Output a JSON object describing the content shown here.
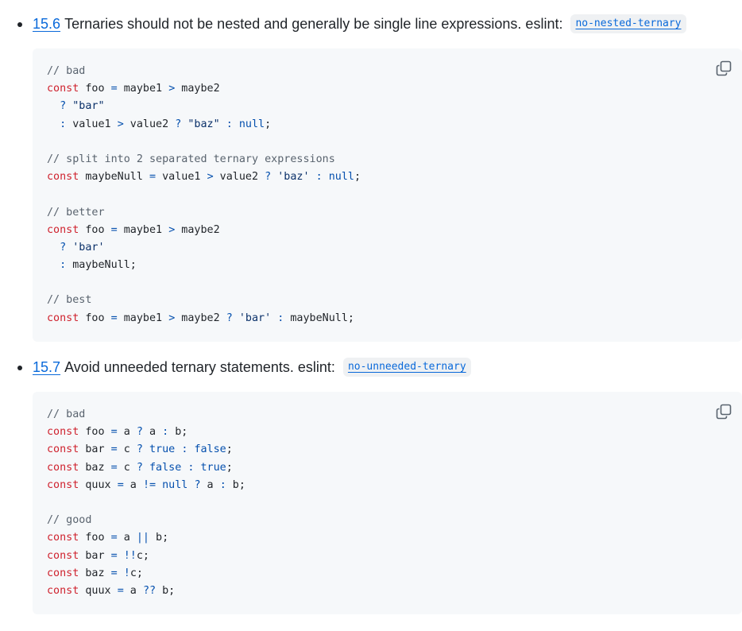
{
  "sections": [
    {
      "number": "15.6",
      "text": "Ternaries should not be nested and generally be single line expressions. eslint:",
      "rule": "no-nested-ternary",
      "copy_icon": "copy-icon",
      "code_lines": [
        [
          [
            "comment",
            "// bad"
          ]
        ],
        [
          [
            "kw",
            "const"
          ],
          [
            "plain",
            " foo "
          ],
          [
            "op",
            "="
          ],
          [
            "plain",
            " maybe1 "
          ],
          [
            "op",
            ">"
          ],
          [
            "plain",
            " maybe2"
          ]
        ],
        [
          [
            "plain",
            "  "
          ],
          [
            "op",
            "?"
          ],
          [
            "plain",
            " "
          ],
          [
            "str",
            "\"bar\""
          ]
        ],
        [
          [
            "plain",
            "  "
          ],
          [
            "op",
            ":"
          ],
          [
            "plain",
            " value1 "
          ],
          [
            "op",
            ">"
          ],
          [
            "plain",
            " value2 "
          ],
          [
            "op",
            "?"
          ],
          [
            "plain",
            " "
          ],
          [
            "str",
            "\"baz\""
          ],
          [
            "plain",
            " "
          ],
          [
            "op",
            ":"
          ],
          [
            "plain",
            " "
          ],
          [
            "kw2",
            "null"
          ],
          [
            "plain",
            ";"
          ]
        ],
        [
          [
            "plain",
            ""
          ]
        ],
        [
          [
            "comment",
            "// split into 2 separated ternary expressions"
          ]
        ],
        [
          [
            "kw",
            "const"
          ],
          [
            "plain",
            " maybeNull "
          ],
          [
            "op",
            "="
          ],
          [
            "plain",
            " value1 "
          ],
          [
            "op",
            ">"
          ],
          [
            "plain",
            " value2 "
          ],
          [
            "op",
            "?"
          ],
          [
            "plain",
            " "
          ],
          [
            "str",
            "'baz'"
          ],
          [
            "plain",
            " "
          ],
          [
            "op",
            ":"
          ],
          [
            "plain",
            " "
          ],
          [
            "kw2",
            "null"
          ],
          [
            "plain",
            ";"
          ]
        ],
        [
          [
            "plain",
            ""
          ]
        ],
        [
          [
            "comment",
            "// better"
          ]
        ],
        [
          [
            "kw",
            "const"
          ],
          [
            "plain",
            " foo "
          ],
          [
            "op",
            "="
          ],
          [
            "plain",
            " maybe1 "
          ],
          [
            "op",
            ">"
          ],
          [
            "plain",
            " maybe2"
          ]
        ],
        [
          [
            "plain",
            "  "
          ],
          [
            "op",
            "?"
          ],
          [
            "plain",
            " "
          ],
          [
            "str",
            "'bar'"
          ]
        ],
        [
          [
            "plain",
            "  "
          ],
          [
            "op",
            ":"
          ],
          [
            "plain",
            " maybeNull;"
          ]
        ],
        [
          [
            "plain",
            ""
          ]
        ],
        [
          [
            "comment",
            "// best"
          ]
        ],
        [
          [
            "kw",
            "const"
          ],
          [
            "plain",
            " foo "
          ],
          [
            "op",
            "="
          ],
          [
            "plain",
            " maybe1 "
          ],
          [
            "op",
            ">"
          ],
          [
            "plain",
            " maybe2 "
          ],
          [
            "op",
            "?"
          ],
          [
            "plain",
            " "
          ],
          [
            "str",
            "'bar'"
          ],
          [
            "plain",
            " "
          ],
          [
            "op",
            ":"
          ],
          [
            "plain",
            " maybeNull;"
          ]
        ]
      ]
    },
    {
      "number": "15.7",
      "text": "Avoid unneeded ternary statements. eslint:",
      "rule": "no-unneeded-ternary",
      "copy_icon": "copy-icon",
      "code_lines": [
        [
          [
            "comment",
            "// bad"
          ]
        ],
        [
          [
            "kw",
            "const"
          ],
          [
            "plain",
            " foo "
          ],
          [
            "op",
            "="
          ],
          [
            "plain",
            " a "
          ],
          [
            "op",
            "?"
          ],
          [
            "plain",
            " a "
          ],
          [
            "op",
            ":"
          ],
          [
            "plain",
            " b;"
          ]
        ],
        [
          [
            "kw",
            "const"
          ],
          [
            "plain",
            " bar "
          ],
          [
            "op",
            "="
          ],
          [
            "plain",
            " c "
          ],
          [
            "op",
            "?"
          ],
          [
            "plain",
            " "
          ],
          [
            "kw2",
            "true"
          ],
          [
            "plain",
            " "
          ],
          [
            "op",
            ":"
          ],
          [
            "plain",
            " "
          ],
          [
            "kw2",
            "false"
          ],
          [
            "plain",
            ";"
          ]
        ],
        [
          [
            "kw",
            "const"
          ],
          [
            "plain",
            " baz "
          ],
          [
            "op",
            "="
          ],
          [
            "plain",
            " c "
          ],
          [
            "op",
            "?"
          ],
          [
            "plain",
            " "
          ],
          [
            "kw2",
            "false"
          ],
          [
            "plain",
            " "
          ],
          [
            "op",
            ":"
          ],
          [
            "plain",
            " "
          ],
          [
            "kw2",
            "true"
          ],
          [
            "plain",
            ";"
          ]
        ],
        [
          [
            "kw",
            "const"
          ],
          [
            "plain",
            " quux "
          ],
          [
            "op",
            "="
          ],
          [
            "plain",
            " a "
          ],
          [
            "op",
            "!="
          ],
          [
            "plain",
            " "
          ],
          [
            "kw2",
            "null"
          ],
          [
            "plain",
            " "
          ],
          [
            "op",
            "?"
          ],
          [
            "plain",
            " a "
          ],
          [
            "op",
            ":"
          ],
          [
            "plain",
            " b;"
          ]
        ],
        [
          [
            "plain",
            ""
          ]
        ],
        [
          [
            "comment",
            "// good"
          ]
        ],
        [
          [
            "kw",
            "const"
          ],
          [
            "plain",
            " foo "
          ],
          [
            "op",
            "="
          ],
          [
            "plain",
            " a "
          ],
          [
            "op2",
            "||"
          ],
          [
            "plain",
            " b;"
          ]
        ],
        [
          [
            "kw",
            "const"
          ],
          [
            "plain",
            " bar "
          ],
          [
            "op",
            "="
          ],
          [
            "plain",
            " "
          ],
          [
            "op",
            "!!"
          ],
          [
            "plain",
            "c;"
          ]
        ],
        [
          [
            "kw",
            "const"
          ],
          [
            "plain",
            " baz "
          ],
          [
            "op",
            "="
          ],
          [
            "plain",
            " "
          ],
          [
            "op",
            "!"
          ],
          [
            "plain",
            "c;"
          ]
        ],
        [
          [
            "kw",
            "const"
          ],
          [
            "plain",
            " quux "
          ],
          [
            "op",
            "="
          ],
          [
            "plain",
            " a "
          ],
          [
            "op2",
            "??"
          ],
          [
            "plain",
            " b;"
          ]
        ]
      ]
    }
  ],
  "colors": {
    "link": "#0969da",
    "code_bg": "#f6f8fa",
    "inline_code_bg": "#eff1f3",
    "keyword": "#cf222e",
    "literal": "#0550ae",
    "string": "#0a3069",
    "comment": "#59636e"
  }
}
